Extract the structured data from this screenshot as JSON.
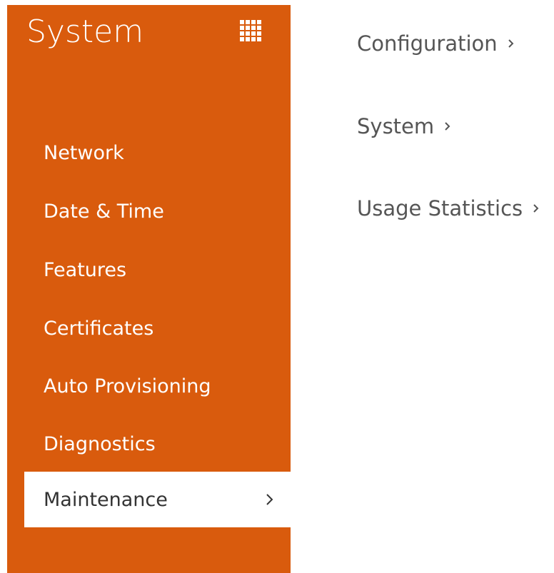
{
  "sidebar": {
    "title": "System",
    "grid_icon": "grid-icon",
    "items": [
      {
        "label": "Network",
        "active": false
      },
      {
        "label": "Date & Time",
        "active": false
      },
      {
        "label": "Features",
        "active": false
      },
      {
        "label": "Certificates",
        "active": false
      },
      {
        "label": "Auto Provisioning",
        "active": false
      },
      {
        "label": "Diagnostics",
        "active": false
      },
      {
        "label": "Maintenance",
        "active": true
      }
    ]
  },
  "main": {
    "items": [
      {
        "label": "Configuration"
      },
      {
        "label": "System"
      },
      {
        "label": "Usage Statistics"
      }
    ]
  },
  "colors": {
    "sidebar_bg": "#d95b0d",
    "active_bg": "#ffffff",
    "content_text": "#555555"
  }
}
